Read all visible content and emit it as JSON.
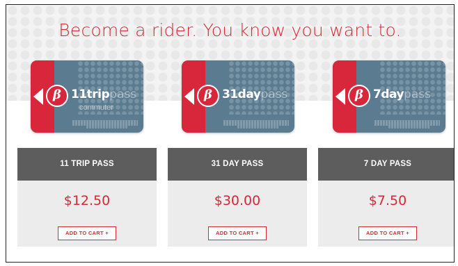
{
  "headline": "Become a rider. You know you want to.",
  "colors": {
    "accent": "#d42a37",
    "panel_header": "#5d5d5d",
    "card_blue": "#5a7b90",
    "card_red": "#d8263a"
  },
  "products": [
    {
      "card": {
        "logo": "β",
        "name_bold": "11trip",
        "name_light": "pass",
        "sub": "commuter"
      },
      "title": "11 TRIP PASS",
      "price": "$12.50",
      "button": "ADD TO CART +"
    },
    {
      "card": {
        "logo": "β",
        "name_bold": "31day",
        "name_light": "pass",
        "sub": ""
      },
      "title": "31 DAY PASS",
      "price": "$30.00",
      "button": "ADD TO CART +"
    },
    {
      "card": {
        "logo": "β",
        "name_bold": "7day",
        "name_light": "pass",
        "sub": ""
      },
      "title": "7 DAY PASS",
      "price": "$7.50",
      "button": "ADD TO CART +"
    }
  ]
}
